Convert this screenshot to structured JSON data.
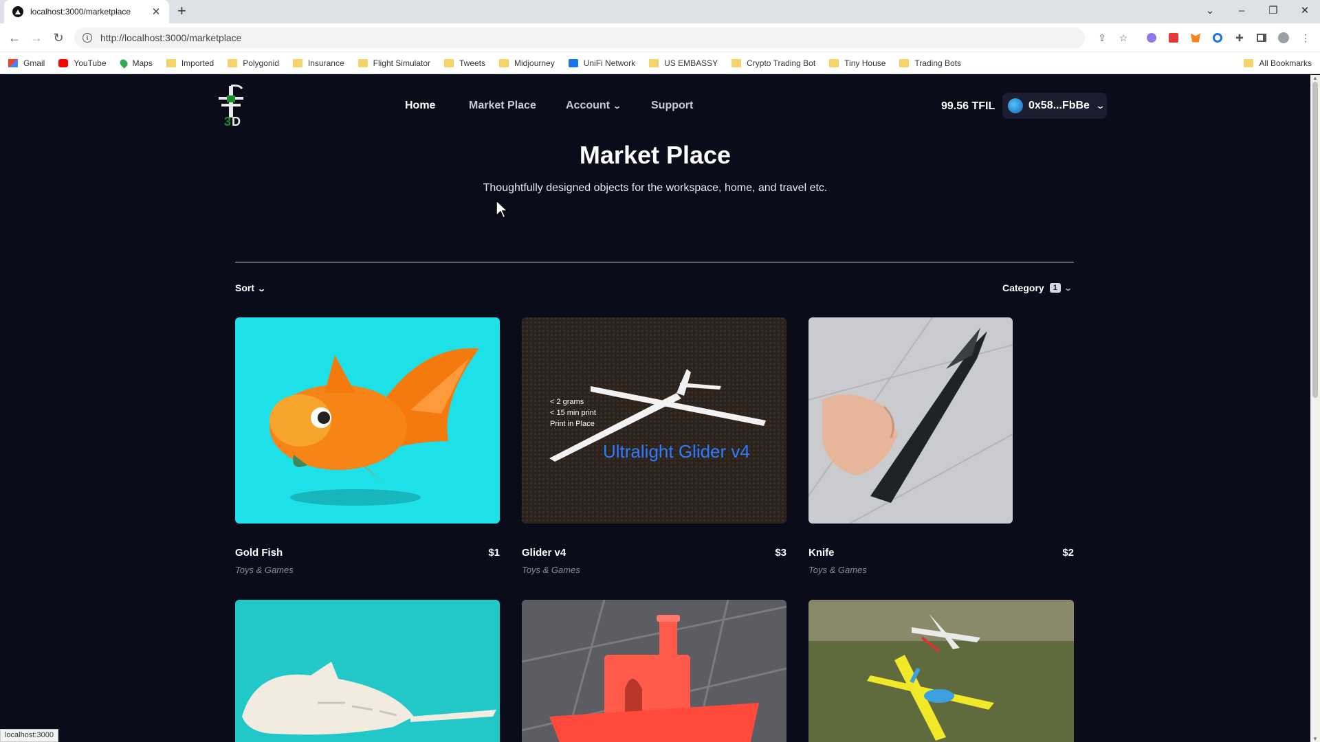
{
  "browser": {
    "tab_title": "localhost:3000/marketplace",
    "url": "http://localhost:3000/marketplace",
    "bookmarks": [
      "Gmail",
      "YouTube",
      "Maps",
      "Imported",
      "Polygonid",
      "Insurance",
      "Flight Simulator",
      "Tweets",
      "Midjourney",
      "UniFi Network",
      "US EMBASSY",
      "Crypto Trading Bot",
      "Tiny House",
      "Trading Bots"
    ],
    "all_bookmarks": "All Bookmarks",
    "status_url": "localhost:3000"
  },
  "nav": {
    "home": "Home",
    "marketplace": "Market Place",
    "account": "Account",
    "support": "Support"
  },
  "wallet": {
    "balance": "99.56 TFIL",
    "address": "0x58...FbBe"
  },
  "header": {
    "title": "Market Place",
    "subtitle": "Thoughtfully designed objects for the workspace, home, and travel etc."
  },
  "filters": {
    "sort_label": "Sort",
    "category_label": "Category",
    "category_count": "1"
  },
  "products": [
    {
      "name": "Gold Fish",
      "price": "$1",
      "category": "Toys & Games"
    },
    {
      "name": "Glider v4",
      "price": "$3",
      "category": "Toys & Games",
      "image_text": {
        "line1": "< 2 grams",
        "line2": "< 15 min print",
        "line3": "Print in Place",
        "banner": "Ultralight Glider v4"
      }
    },
    {
      "name": "Knife",
      "price": "$2",
      "category": "Toys & Games"
    }
  ],
  "colors": {
    "page_bg": "#0b0c1a",
    "fish_bg": "#1ee0e8",
    "shark_bg": "#22c8c8",
    "glider_banner": "#2f7bff"
  }
}
